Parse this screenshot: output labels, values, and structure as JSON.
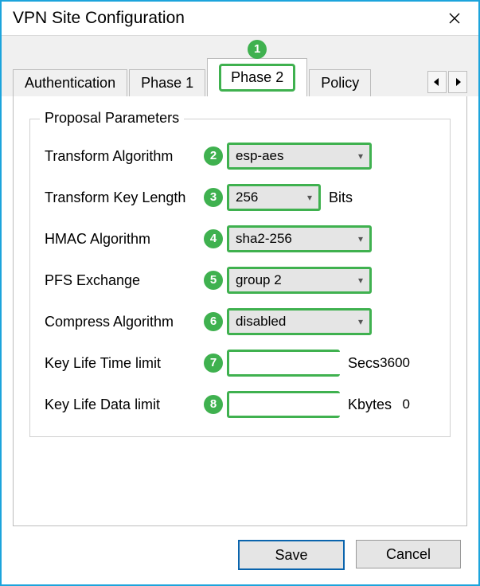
{
  "window": {
    "title": "VPN Site Configuration"
  },
  "tabs": {
    "items": [
      "Authentication",
      "Phase 1",
      "Phase 2",
      "Policy"
    ],
    "active": "Phase 2"
  },
  "annotations": {
    "tab_badge": "1",
    "transform_algorithm": "2",
    "transform_key_length": "3",
    "hmac_algorithm": "4",
    "pfs_exchange": "5",
    "compress_algorithm": "6",
    "key_life_time": "7",
    "key_life_data": "8"
  },
  "group": {
    "legend": "Proposal Parameters"
  },
  "fields": {
    "transform_algorithm": {
      "label": "Transform Algorithm",
      "value": "esp-aes"
    },
    "transform_key_length": {
      "label": "Transform Key Length",
      "value": "256",
      "unit": "Bits"
    },
    "hmac_algorithm": {
      "label": "HMAC Algorithm",
      "value": "sha2-256"
    },
    "pfs_exchange": {
      "label": "PFS Exchange",
      "value": "group 2"
    },
    "compress_algorithm": {
      "label": "Compress Algorithm",
      "value": "disabled"
    },
    "key_life_time": {
      "label": "Key Life Time limit",
      "value": "3600",
      "unit": "Secs"
    },
    "key_life_data": {
      "label": "Key Life Data limit",
      "value": "0",
      "unit": "Kbytes"
    }
  },
  "buttons": {
    "save": "Save",
    "cancel": "Cancel"
  }
}
